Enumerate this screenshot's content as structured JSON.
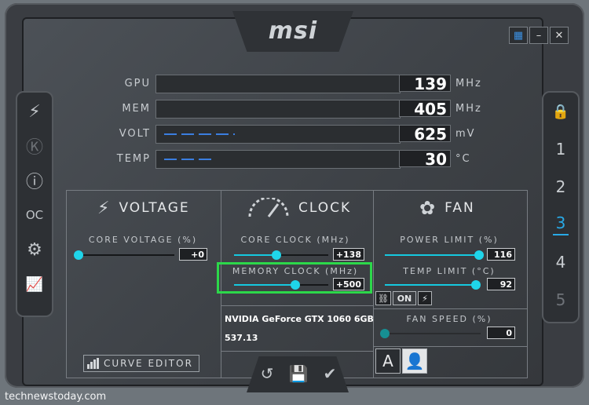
{
  "app": {
    "logo": "msi"
  },
  "window_controls": {
    "windows_icon": "windows-icon",
    "minimize": "–",
    "close": "✕"
  },
  "left_sidebar": [
    {
      "name": "oc-scanner-icon",
      "glyph": "⚡"
    },
    {
      "name": "k-boost-icon",
      "glyph": "Ⓚ"
    },
    {
      "name": "info-icon",
      "glyph": "ⓘ"
    },
    {
      "name": "oc-icon",
      "glyph": "OC"
    },
    {
      "name": "settings-gear-icon",
      "glyph": "⚙"
    },
    {
      "name": "monitor-icon",
      "glyph": "📈"
    }
  ],
  "right_sidebar": {
    "lock": "🔒",
    "profiles": [
      "1",
      "2",
      "3",
      "4",
      "5"
    ],
    "active_profile": "3"
  },
  "monitor": [
    {
      "label": "GPU",
      "value": "139",
      "unit": "MHz"
    },
    {
      "label": "MEM",
      "value": "405",
      "unit": "MHz"
    },
    {
      "label": "VOLT",
      "value": "625",
      "unit": "mV"
    },
    {
      "label": "TEMP",
      "value": "30",
      "unit": "°C"
    }
  ],
  "voltage": {
    "title": "VOLTAGE",
    "core_voltage_label": "CORE VOLTAGE (%)",
    "core_voltage_value": "+0",
    "core_voltage_pos": 0.0,
    "curve_editor": "CURVE EDITOR"
  },
  "clock": {
    "title": "CLOCK",
    "core_clock_label": "CORE CLOCK (MHz)",
    "core_clock_value": "+138",
    "core_clock_pos": 0.45,
    "memory_clock_label": "MEMORY CLOCK (MHz)",
    "memory_clock_value": "+500",
    "memory_clock_pos": 0.65,
    "gpu_name": "NVIDIA GeForce GTX 1060 6GB",
    "driver": "537.13"
  },
  "fan": {
    "title": "FAN",
    "power_limit_label": "POWER LIMIT (%)",
    "power_limit_value": "116",
    "power_limit_pos": 0.98,
    "temp_limit_label": "TEMP LIMIT (°C)",
    "temp_limit_value": "92",
    "temp_limit_pos": 0.95,
    "link_on": "ON",
    "fan_speed_label": "FAN SPEED (%)",
    "fan_speed_value": "0",
    "fan_speed_pos": 0.0,
    "auto_label": "A"
  },
  "bottom": {
    "reset": "↺",
    "save": "💾",
    "apply": "✔"
  },
  "watermark": "technewstoday.com"
}
